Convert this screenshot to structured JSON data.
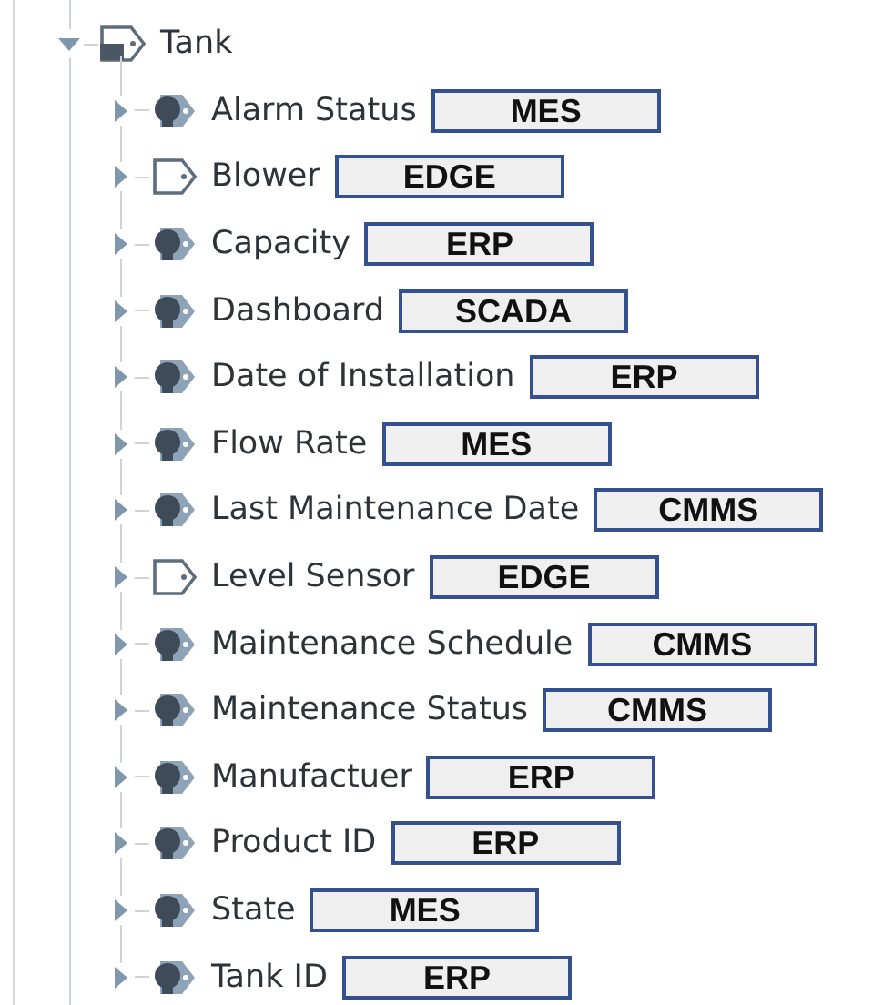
{
  "root": {
    "label": "Tank",
    "expanded": true
  },
  "items": [
    {
      "label": "Alarm Status",
      "kind": "udt",
      "expanded": false,
      "source": "MES"
    },
    {
      "label": "Blower",
      "kind": "tag",
      "expanded": false,
      "source": "EDGE"
    },
    {
      "label": "Capacity",
      "kind": "udt",
      "expanded": false,
      "source": "ERP"
    },
    {
      "label": "Dashboard",
      "kind": "udt",
      "expanded": false,
      "source": "SCADA"
    },
    {
      "label": "Date of Installation",
      "kind": "udt",
      "expanded": false,
      "source": "ERP"
    },
    {
      "label": "Flow Rate",
      "kind": "udt",
      "expanded": false,
      "source": "MES"
    },
    {
      "label": "Last Maintenance Date",
      "kind": "udt",
      "expanded": false,
      "source": "CMMS"
    },
    {
      "label": "Level Sensor",
      "kind": "tag",
      "expanded": false,
      "source": "EDGE"
    },
    {
      "label": "Maintenance Schedule",
      "kind": "udt",
      "expanded": false,
      "source": "CMMS"
    },
    {
      "label": "Maintenance Status",
      "kind": "udt",
      "expanded": false,
      "source": "CMMS"
    },
    {
      "label": "Manufactuer",
      "kind": "udt",
      "expanded": false,
      "source": "ERP"
    },
    {
      "label": "Product ID",
      "kind": "udt",
      "expanded": false,
      "source": "ERP"
    },
    {
      "label": "State",
      "kind": "udt",
      "expanded": false,
      "source": "MES"
    },
    {
      "label": "Tank ID",
      "kind": "udt",
      "expanded": false,
      "source": "ERP"
    }
  ]
}
